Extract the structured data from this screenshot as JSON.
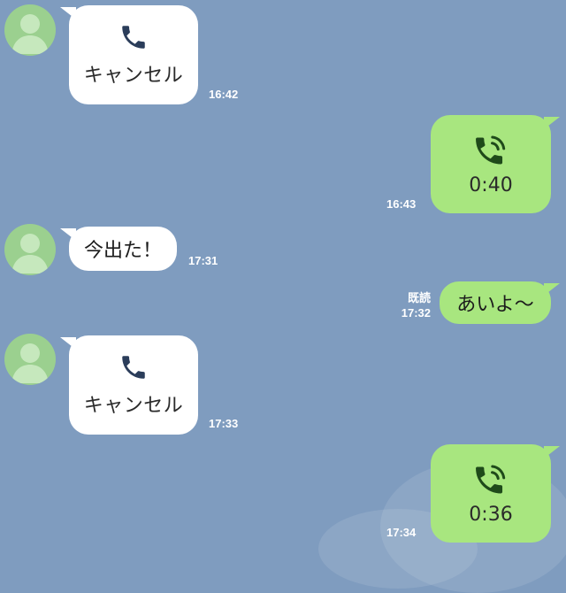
{
  "colors": {
    "background": "#7f9cbf",
    "incoming_bubble": "#ffffff",
    "outgoing_bubble": "#a8e67f",
    "incoming_call_icon": "#2b3d5a",
    "outgoing_call_icon": "#1f4a1a",
    "avatar": "#9bd08f",
    "timestamp": "#ffffff"
  },
  "messages": [
    {
      "kind": "call-cancelled",
      "direction": "incoming",
      "icon": "phone-icon",
      "label": "キャンセル",
      "time": "16:42"
    },
    {
      "kind": "call-completed",
      "direction": "outgoing",
      "icon": "phone-ringing-icon",
      "duration": "0:40",
      "time": "16:43"
    },
    {
      "kind": "text",
      "direction": "incoming",
      "text": "今出た！",
      "time": "17:31"
    },
    {
      "kind": "text",
      "direction": "outgoing",
      "text": "あいよ〜",
      "read": "既読",
      "time": "17:32"
    },
    {
      "kind": "call-cancelled",
      "direction": "incoming",
      "icon": "phone-icon",
      "label": "キャンセル",
      "time": "17:33"
    },
    {
      "kind": "call-completed",
      "direction": "outgoing",
      "icon": "phone-ringing-icon",
      "duration": "0:36",
      "time": "17:34"
    }
  ]
}
